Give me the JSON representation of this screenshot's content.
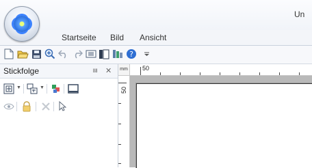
{
  "window": {
    "title": "Un"
  },
  "ribbon": {
    "tabs": [
      "Startseite",
      "Bild",
      "Ansicht"
    ]
  },
  "quick_access": {
    "buttons": [
      "new-file-icon",
      "open-folder-icon",
      "save-icon",
      "zoom-in-icon",
      "undo-icon",
      "redo-icon",
      "list-view-icon",
      "split-view-icon",
      "color-palette-icon",
      "help-icon",
      "customize-dropdown-icon"
    ]
  },
  "panel": {
    "title": "Stickfolge",
    "pin_glyph": "⩏",
    "close_glyph": "✕"
  },
  "canvas": {
    "ruler_unit": "mm",
    "ruler_top_label": "50",
    "ruler_left_label": "50"
  }
}
